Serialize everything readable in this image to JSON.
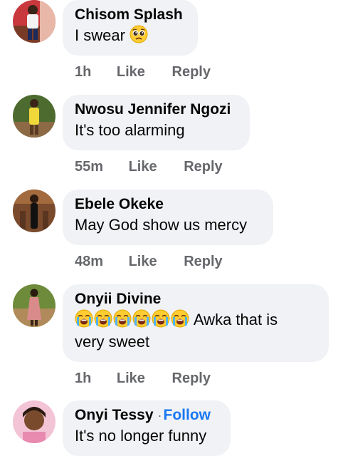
{
  "comments": [
    {
      "author": "Chisom Splash",
      "text": "I swear",
      "emoji": "pleading-face-emoji",
      "time": "1h",
      "like": "Like",
      "reply": "Reply"
    },
    {
      "author": "Nwosu Jennifer Ngozi",
      "text": "It's too alarming",
      "time": "55m",
      "like": "Like",
      "reply": "Reply"
    },
    {
      "author": "Ebele Okeke",
      "text": "May God show us mercy",
      "time": "48m",
      "like": "Like",
      "reply": "Reply"
    },
    {
      "author": "Onyii Divine",
      "emoji": "loudly-crying-face-emoji",
      "emoji_count": 6,
      "text_line1": "Awka that is",
      "text_line2": "very sweet",
      "time": "1h",
      "like": "Like",
      "reply": "Reply"
    },
    {
      "author": "Onyi Tessy",
      "separator": "·",
      "follow": "Follow",
      "text": "It's no longer funny"
    }
  ],
  "colors": {
    "bubble": "#f0f2f5",
    "meta": "#65676b",
    "follow": "#1877f2",
    "text": "#050505"
  }
}
